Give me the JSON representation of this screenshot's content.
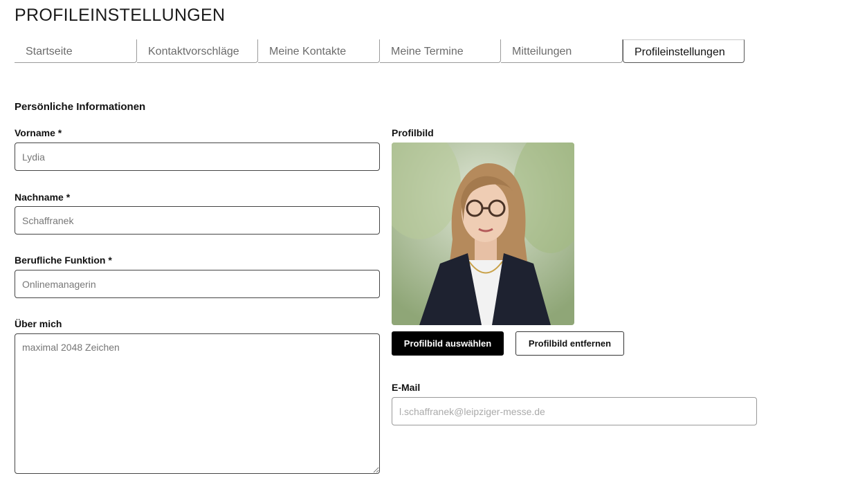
{
  "page": {
    "title": "PROFILEINSTELLUNGEN"
  },
  "tabs": [
    {
      "label": "Startseite",
      "active": false
    },
    {
      "label": "Kontaktvorschläge",
      "active": false
    },
    {
      "label": "Meine Kontakte",
      "active": false
    },
    {
      "label": "Meine Termine",
      "active": false
    },
    {
      "label": "Mitteilungen",
      "active": false
    },
    {
      "label": "Profileinstellungen",
      "active": true
    }
  ],
  "personal": {
    "heading": "Persönliche Informationen",
    "first_name": {
      "label": "Vorname *",
      "value": "Lydia"
    },
    "last_name": {
      "label": "Nachname *",
      "value": "Schaffranek"
    },
    "job_title": {
      "label": "Berufliche Funktion *",
      "value": "Onlinemanagerin"
    },
    "about": {
      "label": "Über mich",
      "placeholder": "maximal 2048 Zeichen",
      "value": ""
    }
  },
  "profile_picture": {
    "label": "Profilbild",
    "select_button": "Profilbild auswählen",
    "remove_button": "Profilbild entfernen"
  },
  "email": {
    "label": "E-Mail",
    "value": "l.schaffranek@leipziger-messe.de"
  }
}
